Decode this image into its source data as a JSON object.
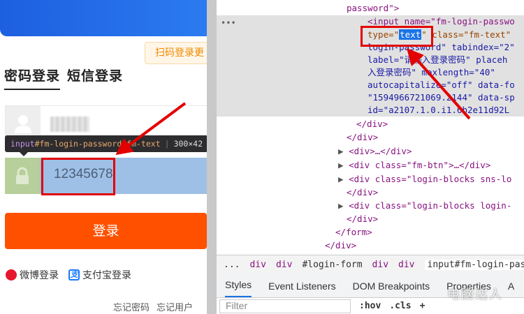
{
  "login": {
    "qr_login": "扫码登录更",
    "tabs": [
      "密码登录",
      "短信登录"
    ],
    "password_value": "12345678",
    "login_button": "登录",
    "social": {
      "weibo": "微博登录",
      "alipay": "支付宝登录"
    },
    "footer": {
      "forgot_password": "忘记密码",
      "forgot_username": "忘记用户"
    },
    "tooltip": {
      "selector_tag": "input",
      "selector_rest": "#fm-login-password.fm-text",
      "size": "300×42"
    }
  },
  "devtools": {
    "code_lines": [
      {
        "text": "password\">"
      },
      {
        "text": "<input name=\"fm-login-passwo"
      },
      {
        "pre": "type=\"",
        "hl": "text",
        "post": "\" class=\"fm-text\""
      },
      {
        "text": "login-password\" tabindex=\"2\""
      },
      {
        "text": "label=\"请输入登录密码\" placeh"
      },
      {
        "text": "入登录密码\" maxlength=\"40\""
      },
      {
        "text": "autocapitalize=\"off\" data-fo"
      },
      {
        "text": "\"1594966721069.2144\" data-sp"
      },
      {
        "text": "id=\"a2107.1.0.i1.6b2e11d92L"
      },
      {
        "text": "</div>"
      },
      {
        "text": "</div>"
      },
      {
        "text": "<div>…</div>"
      },
      {
        "text": "<div class=\"fm-btn\">…</div>"
      },
      {
        "text": "<div class=\"login-blocks sns-lo"
      },
      {
        "text": "</div>"
      },
      {
        "text": "<div class=\"login-blocks login-"
      },
      {
        "text": "</div>"
      },
      {
        "text": "</form>"
      },
      {
        "text": "</div>"
      }
    ],
    "breadcrumbs": [
      "...",
      "div",
      "div",
      "#login-form",
      "div",
      "div",
      "input#fm-login-passwo"
    ],
    "tabs": [
      "Styles",
      "Event Listeners",
      "DOM Breakpoints",
      "Properties",
      "A"
    ],
    "filter_placeholder": "Filter",
    "hov": ":hov",
    "cls": ".cls",
    "add": "+"
  },
  "watermark": "电脑达人"
}
